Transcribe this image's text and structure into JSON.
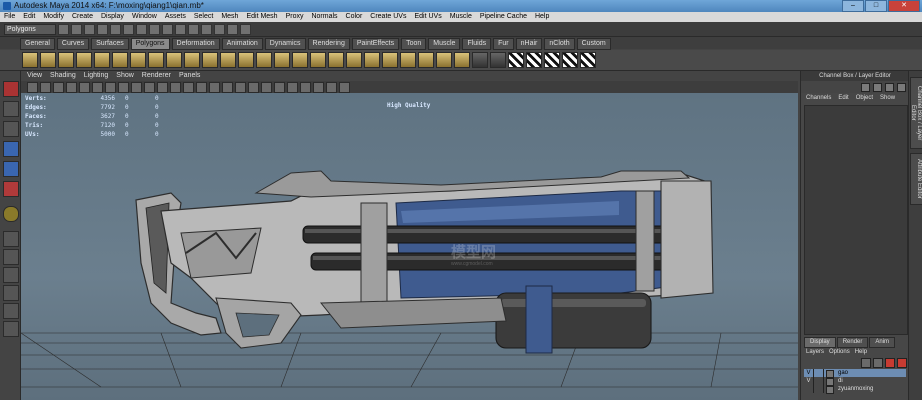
{
  "title": "Autodesk Maya 2014 x64: F:\\moxing\\qiang1\\qian.mb*",
  "window_buttons": {
    "minimize": "–",
    "maximize": "□",
    "close": "✕"
  },
  "menubar": [
    "File",
    "Edit",
    "Modify",
    "Create",
    "Display",
    "Window",
    "Assets",
    "Select",
    "Mesh",
    "Edit Mesh",
    "Proxy",
    "Normals",
    "Color",
    "Create UVs",
    "Edit UVs",
    "Muscle",
    "Pipeline Cache",
    "Help"
  ],
  "status_line": {
    "mode": "Polygons"
  },
  "shelf_tabs": [
    "General",
    "Curves",
    "Surfaces",
    "Polygons",
    "Deformation",
    "Animation",
    "Dynamics",
    "Rendering",
    "PaintEffects",
    "Toon",
    "Muscle",
    "Fluids",
    "Fur",
    "nHair",
    "nCloth",
    "Custom"
  ],
  "shelf_active": "Polygons",
  "panel_menu": [
    "View",
    "Shading",
    "Lighting",
    "Show",
    "Renderer",
    "Panels"
  ],
  "hud": {
    "rows": [
      {
        "label": "Verts:",
        "value": "4356",
        "a": "0",
        "b": "0"
      },
      {
        "label": "Edges:",
        "value": "7792",
        "a": "0",
        "b": "0"
      },
      {
        "label": "Faces:",
        "value": "3627",
        "a": "0",
        "b": "0"
      },
      {
        "label": "Tris:",
        "value": "7120",
        "a": "0",
        "b": "0"
      },
      {
        "label": "UVs:",
        "value": "5000",
        "a": "0",
        "b": "0"
      }
    ],
    "quality": "High Quality"
  },
  "watermark": {
    "main": "模型网",
    "sub": "www.cgmodel.com"
  },
  "channel_box": {
    "header": "Channel Box / Layer Editor",
    "menu": [
      "Channels",
      "Edit",
      "Object",
      "Show"
    ],
    "display_tabs": [
      "Display",
      "Render",
      "Anim"
    ],
    "active_tab": "Display",
    "layer_menu": [
      "Layers",
      "Options",
      "Help"
    ],
    "layers": [
      {
        "v": "V",
        "name": "gao",
        "selected": true
      },
      {
        "v": "V",
        "name": "di",
        "selected": false
      },
      {
        "v": "",
        "name": "zyuanmoxing",
        "selected": false
      }
    ]
  },
  "side_tabs": [
    "Channel Box / Layer Editor",
    "Attribute Editor"
  ],
  "colors": {
    "accent": "#6d8db3",
    "viewport_bg": "#6b7f8e",
    "gun_blue": "#3f5b8f",
    "gun_metal": "#bdbdbd"
  }
}
